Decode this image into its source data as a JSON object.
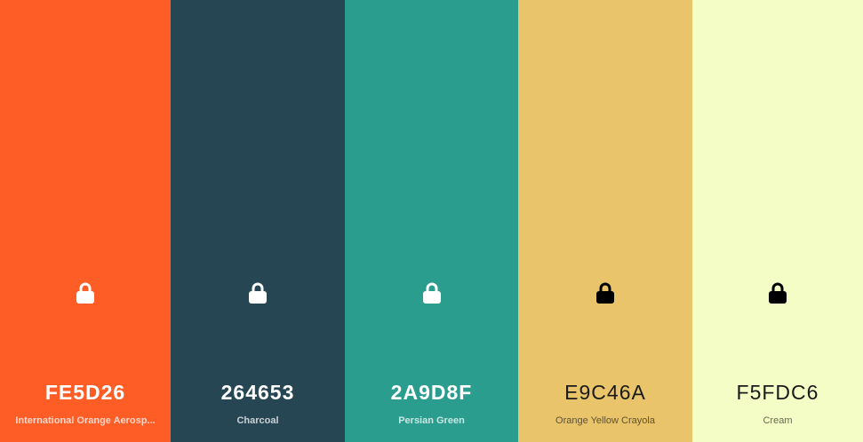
{
  "palette": {
    "colors": [
      {
        "hex": "FE5D26",
        "name": "International Orange Aerosp...",
        "color": "#FE5D26",
        "lock_icon": "lock-icon"
      },
      {
        "hex": "264653",
        "name": "Charcoal",
        "color": "#264653",
        "lock_icon": "lock-icon"
      },
      {
        "hex": "2A9D8F",
        "name": "Persian Green",
        "color": "#2A9D8F",
        "lock_icon": "lock-icon"
      },
      {
        "hex": "E9C46A",
        "name": "Orange Yellow Crayola",
        "color": "#E9C46A",
        "lock_icon": "lock-icon"
      },
      {
        "hex": "F5FDC6",
        "name": "Cream",
        "color": "#F5FDC6",
        "lock_icon": "lock-icon"
      }
    ]
  }
}
